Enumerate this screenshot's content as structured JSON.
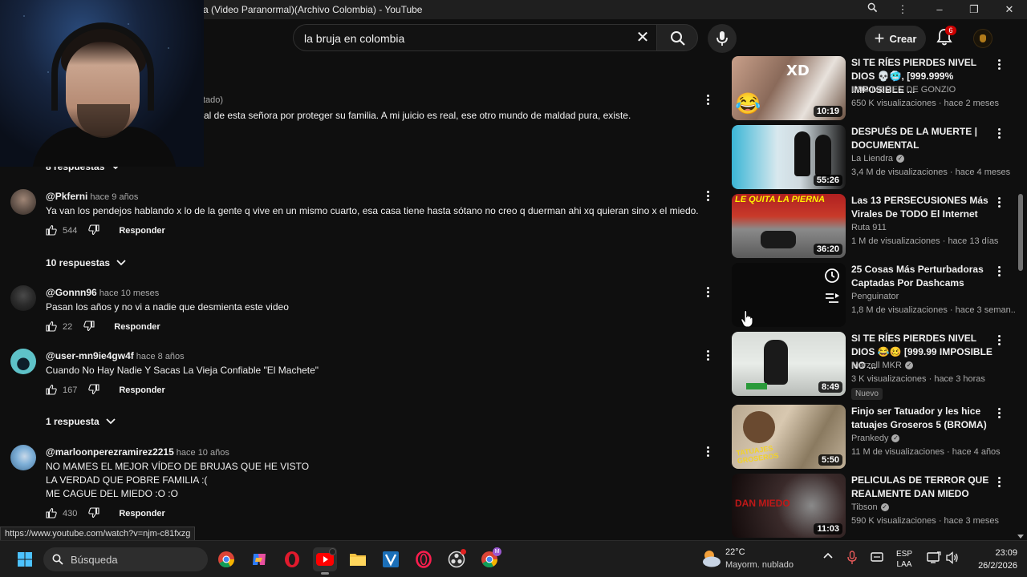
{
  "window": {
    "title": "a (Video Paranormal)(Archivo Colombia) - YouTube"
  },
  "masthead": {
    "search_query": "la bruja en colombia",
    "create_label": "Crear",
    "notifications_count": "6"
  },
  "comments": {
    "partial_top": {
      "author_fragment": "tado)",
      "text_fragment": "al de esta señora por proteger su familia. A mi juicio es real, ese otro mundo de maldad pura, existe.",
      "replies_label": "8 respuestas"
    },
    "items": [
      {
        "author": "@Pkferni",
        "time": "hace 9 años",
        "lines": [
          "Ya van los pendejos hablando x lo de la gente q vive en un mismo cuarto, esa casa tiene hasta sótano no creo q duerman ahi xq quieran sino x el miedo."
        ],
        "likes": "544",
        "reply_label": "Responder",
        "replies_label": "10 respuestas",
        "avatar_color": "#6b5a50"
      },
      {
        "author": "@Gonnn96",
        "time": "hace 10 meses",
        "lines": [
          "Pasan los años y no vi a nadie que desmienta este video"
        ],
        "likes": "22",
        "reply_label": "Responder",
        "replies_label": "",
        "avatar_color": "#2a2a2a"
      },
      {
        "author": "@user-mn9ie4gw4f",
        "time": "hace 8 años",
        "lines": [
          "Cuando No Hay Nadie Y Sacas La Vieja Confiable \"El Machete\""
        ],
        "likes": "167",
        "reply_label": "Responder",
        "replies_label": "1 respuesta",
        "avatar_color": "#5ec2c8"
      },
      {
        "author": "@marloonperezramirez2215",
        "time": "hace 10 años",
        "lines": [
          "NO MAMES EL MEJOR VÍDEO DE BRUJAS QUE HE VISTO",
          "LA VERDAD QUE POBRE FAMILIA :(",
          "ME CAGUE DEL MIEDO  :O :O"
        ],
        "likes": "430",
        "reply_label": "Responder",
        "replies_label": "",
        "avatar_color": "#7fb0d8"
      }
    ]
  },
  "recommendations": [
    {
      "title": "SI TE RÍES PIERDES NIVEL DIOS 💀🥶, [999.999% IMPOSIBLE ...",
      "channel": "LOS MEMES DE GONZIO",
      "verified": false,
      "meta": "650 K visualizaciones · hace 2 meses",
      "duration": "10:19",
      "badge": "",
      "thumb_overlay": "XD"
    },
    {
      "title": "DESPUÉS DE LA MUERTE | DOCUMENTAL",
      "channel": "La Liendra",
      "verified": true,
      "meta": "3,4 M de visualizaciones · hace 4 meses",
      "duration": "55:26",
      "badge": "",
      "thumb_overlay": ""
    },
    {
      "title": "Las 13 PERSECUSIONES Más Virales De TODO El Internet",
      "channel": "Ruta 911",
      "verified": false,
      "meta": "1 M de visualizaciones · hace 13 días",
      "duration": "36:20",
      "badge": "",
      "thumb_overlay": "LE QUITA LA PIERNA"
    },
    {
      "title": "25 Cosas Más Perturbadoras Captadas Por Dashcams",
      "channel": "Penguinator",
      "verified": false,
      "meta": "1,8 M de visualizaciones · hace 3 seman...",
      "duration": "",
      "badge": "",
      "thumb_overlay": ""
    },
    {
      "title": "SI TE RÍES PIERDES NIVEL DIOS 😂🥴 [999.99 IMPOSIBLE NO ...",
      "channel": "Marzell MKR",
      "verified": true,
      "meta": "3 K visualizaciones · hace 3 horas",
      "duration": "8:49",
      "badge": "Nuevo",
      "thumb_overlay": ""
    },
    {
      "title": "Finjo ser Tatuador y les hice tatuajes Groseros 5 (BROMA)",
      "channel": "Prankedy",
      "verified": true,
      "meta": "11 M de visualizaciones · hace 4 años",
      "duration": "5:50",
      "badge": "",
      "thumb_overlay": "TATUAJES GROSEROS"
    },
    {
      "title": "PELICULAS DE TERROR QUE REALMENTE DAN MIEDO",
      "channel": "Tibson",
      "verified": true,
      "meta": "590 K visualizaciones · hace 3 meses",
      "duration": "11:03",
      "badge": "",
      "thumb_overlay": "DAN MIEDO"
    }
  ],
  "status_url": "https://www.youtube.com/watch?v=njm-c81fxzg",
  "taskbar": {
    "search_label": "Búsqueda",
    "weather_temp": "22°C",
    "weather_cond": "Mayorm. nublado",
    "lang_line1": "ESP",
    "lang_line2": "LAA",
    "time": "23:09",
    "date": "26/2/2026"
  },
  "colors": {
    "background": "#0f0f0f",
    "text": "#f1f1f1",
    "secondary_text": "#aaaaaa",
    "accent_red": "#cc0000"
  }
}
